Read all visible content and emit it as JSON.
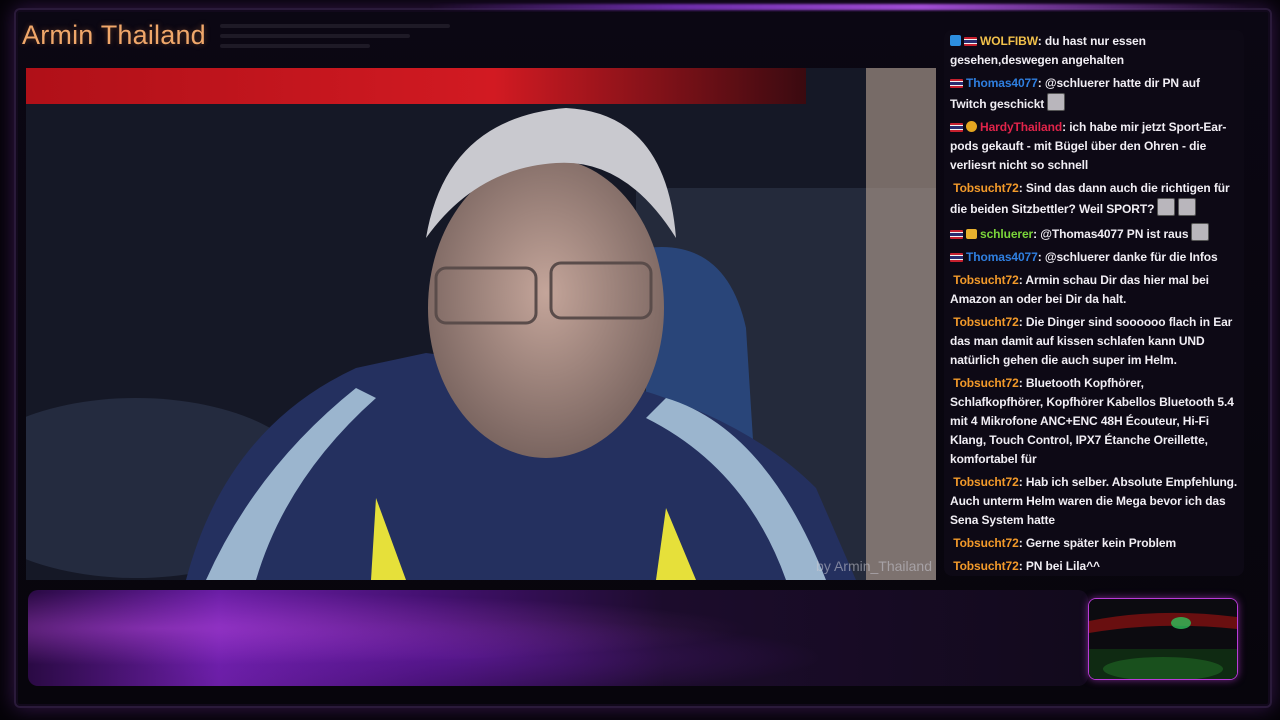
{
  "overlay": {
    "channel_title": "Armin Thailand",
    "watermark": "by Armin_Thailand",
    "accent_color": "#f0a76a",
    "frame_glow_color": "#a24dd6"
  },
  "chat": {
    "messages": [
      {
        "badges": [
          "prime-badge",
          "thai-flag-badge"
        ],
        "user": "WOLFIBW",
        "color": "#f2c14b",
        "text": ": du hast nur essen gesehen,deswegen angehalten",
        "emotes": []
      },
      {
        "badges": [
          "thai-flag-badge"
        ],
        "user": "Thomas4077",
        "color": "#2f7fe0",
        "text": ": @schluerer hatte dir PN auf Twitch geschickt",
        "emotes": [
          "emote"
        ]
      },
      {
        "badges": [
          "thai-flag-badge",
          "sub-badge"
        ],
        "user": "HardyThailand",
        "color": "#e0244a",
        "text": ": ich habe mir jetzt Sport-Ear-pods gekauft - mit Bügel über den Ohren - die verliesrt nicht so schnell",
        "emotes": []
      },
      {
        "badges": [],
        "user": "Tobsucht72",
        "color": "#f39a2a",
        "text": ": Sind das dann auch die richtigen für die beiden Sitzbettler? Weil SPORT?",
        "emotes": [
          "emote",
          "emote"
        ]
      },
      {
        "badges": [
          "thai-flag-badge",
          "crown-badge"
        ],
        "user": "schluerer",
        "color": "#7ad43a",
        "text": ": @Thomas4077 PN ist raus",
        "emotes": [
          "emote"
        ]
      },
      {
        "badges": [
          "thai-flag-badge"
        ],
        "user": "Thomas4077",
        "color": "#2f7fe0",
        "text": ": @schluerer danke für die Infos",
        "emotes": []
      },
      {
        "badges": [],
        "user": "Tobsucht72",
        "color": "#f39a2a",
        "text": ": Armin schau Dir das hier mal bei Amazon an oder bei Dir da halt.",
        "emotes": []
      },
      {
        "badges": [],
        "user": "Tobsucht72",
        "color": "#f39a2a",
        "text": ": Die Dinger sind soooooo flach in Ear das man damit auf kissen schlafen kann UND natürlich gehen die auch super im Helm.",
        "emotes": []
      },
      {
        "badges": [],
        "user": "Tobsucht72",
        "color": "#f39a2a",
        "text": ": Bluetooth Kopfhörer, Schlafkopfhörer, Kopfhörer Kabellos Bluetooth 5.4 mit 4 Mikrofone ANC+ENC 48H Écouteur, Hi-Fi Klang, Touch Control, IPX7 Étanche Oreillette, komfortabel für",
        "emotes": []
      },
      {
        "badges": [],
        "user": "Tobsucht72",
        "color": "#f39a2a",
        "text": ": Hab ich selber. Absolute Empfehlung. Auch unterm Helm waren die Mega bevor ich das Sena System hatte",
        "emotes": []
      },
      {
        "badges": [],
        "user": "Tobsucht72",
        "color": "#f39a2a",
        "text": ": Gerne später kein Problem",
        "emotes": []
      },
      {
        "badges": [],
        "user": "Tobsucht72",
        "color": "#f39a2a",
        "text": ": PN bei Lila^^",
        "emotes": []
      }
    ]
  }
}
